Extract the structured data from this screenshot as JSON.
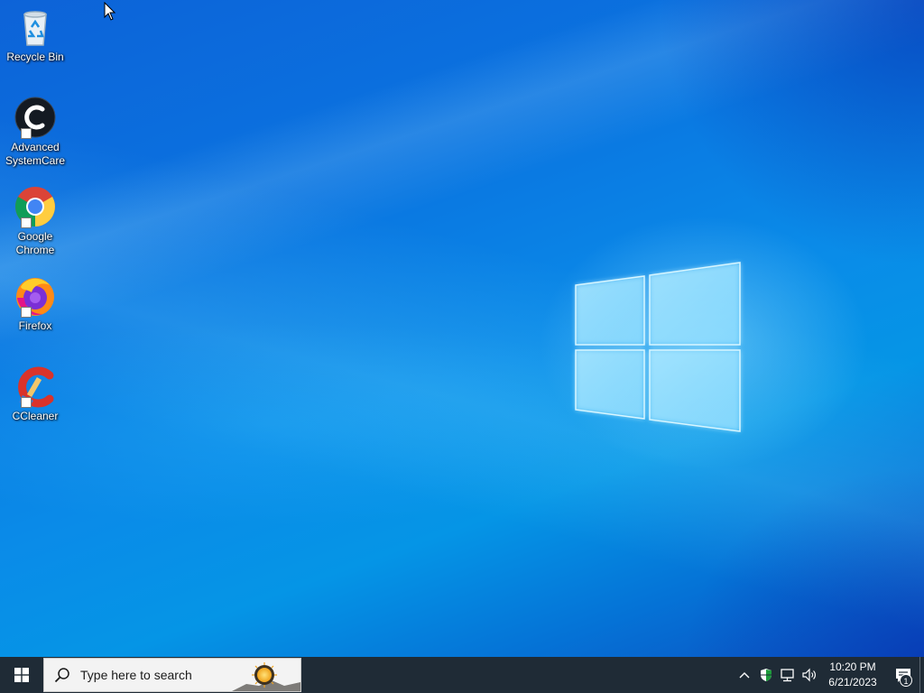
{
  "desktop": {
    "icons": [
      {
        "label": "Recycle Bin",
        "icon": "recycle-bin-icon"
      },
      {
        "label": "Advanced SystemCare",
        "icon": "advanced-systemcare-icon"
      },
      {
        "label": "Google Chrome",
        "icon": "chrome-icon"
      },
      {
        "label": "Firefox",
        "icon": "firefox-icon"
      },
      {
        "label": "CCleaner",
        "icon": "ccleaner-icon"
      }
    ],
    "icon_line2": {
      "advanced": "SystemCare",
      "chrome": "Chrome"
    },
    "icon_line1": {
      "advanced": "Advanced",
      "chrome": "Google"
    }
  },
  "taskbar": {
    "start_icon": "windows-start-icon",
    "search_placeholder": "Type here to search",
    "search_icon": "search-icon",
    "tray": {
      "chevron_icon": "chevron-up-icon",
      "security_icon": "shield-icon",
      "network_icon": "network-icon",
      "volume_icon": "volume-icon",
      "time": "10:20 PM",
      "date": "6/21/2023",
      "notification_icon": "notification-icon",
      "notification_count": "1"
    }
  },
  "colors": {
    "taskbar": "#1f2b36",
    "desktop_blue": "#0a8be8",
    "search_bg": "#f3f3f3"
  }
}
